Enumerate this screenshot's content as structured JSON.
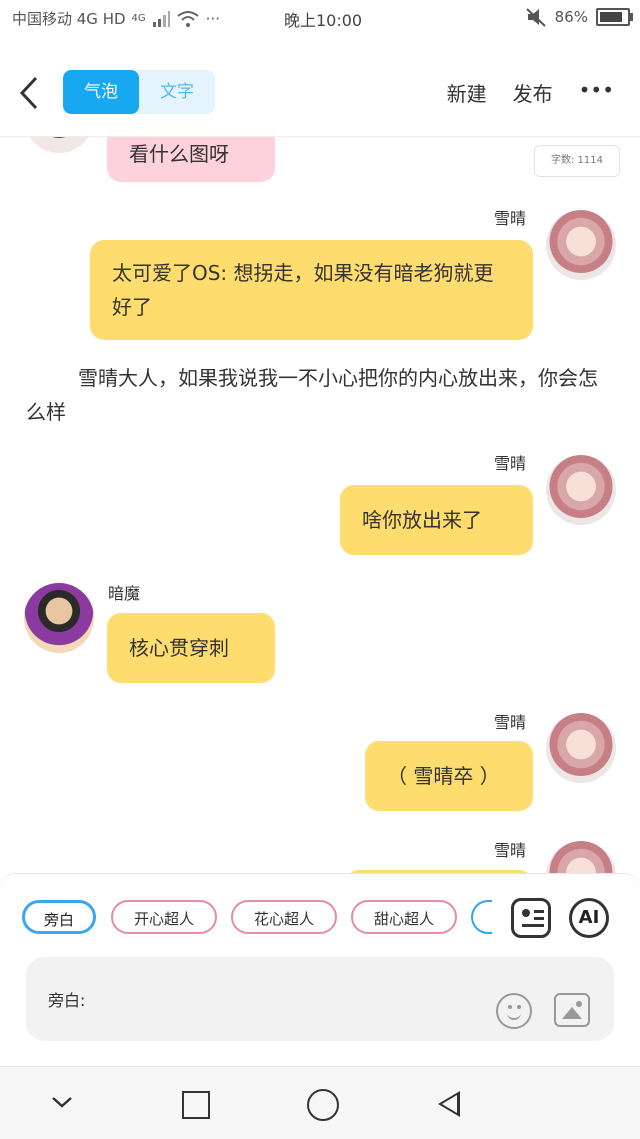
{
  "status_bar": {
    "carrier": "中国移动 4G HD",
    "network": "4G",
    "more": "···",
    "time": "晚上10:00",
    "battery": "86%"
  },
  "header": {
    "back_icon": "chevron-left-icon",
    "tabs": [
      {
        "label": "气泡",
        "active": true
      },
      {
        "label": "文字",
        "active": false
      }
    ],
    "new_label": "新建",
    "publish_label": "发布",
    "more_label": "•••"
  },
  "chat": {
    "word_count": "字数: 1114",
    "messages": [
      {
        "type": "bubble",
        "side": "left",
        "speaker": "",
        "text": "看什么图呀",
        "color": "#fdd2dc"
      },
      {
        "type": "bubble",
        "side": "right",
        "speaker": "雪晴",
        "text": "太可爱了OS: 想拐走，如果没有暗老狗就更好了",
        "color": "#fedc6e"
      },
      {
        "type": "narration",
        "text": "雪晴大人，如果我说我一不小心把你的内心放出来，你会怎么样"
      },
      {
        "type": "bubble",
        "side": "right",
        "speaker": "雪晴",
        "text": "啥你放出来了",
        "color": "#fedc6e"
      },
      {
        "type": "bubble",
        "side": "left",
        "speaker": "暗魔",
        "text": "核心贯穿刺",
        "color": "#fedc6e"
      },
      {
        "type": "bubble",
        "side": "right",
        "speaker": "雪晴",
        "text": "（ 雪晴卒 ）",
        "color": "#fedc6e"
      },
      {
        "type": "bubble",
        "side": "right",
        "speaker": "雪晴",
        "text": "",
        "color": "#fedc6e"
      }
    ]
  },
  "composer": {
    "chips": [
      {
        "label": "旁白",
        "active": true
      },
      {
        "label": "开心超人",
        "active": false
      },
      {
        "label": "花心超人",
        "active": false
      },
      {
        "label": "甜心超人",
        "active": false
      }
    ],
    "ai_label": "AI",
    "input_label": "旁白:",
    "icons": [
      "list-card-icon",
      "ai-icon",
      "emoji-icon",
      "image-icon"
    ]
  },
  "nav": {
    "icons": [
      "chevron-down-icon",
      "square-icon",
      "circle-icon",
      "triangle-back-icon"
    ]
  }
}
